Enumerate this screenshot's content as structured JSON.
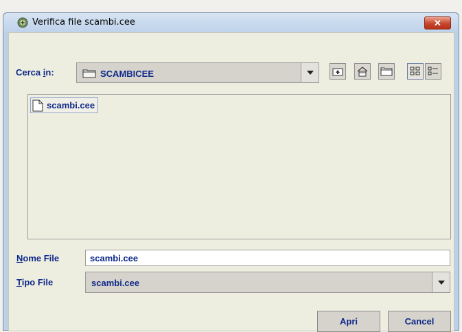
{
  "window": {
    "title": "Verifica file scambi.cee",
    "close_label": "✕"
  },
  "lookin": {
    "label_prefix": "Cerca ",
    "label_mnemonic": "i",
    "label_suffix": "n:",
    "folder": "SCAMBICEE"
  },
  "toolbar": {
    "icons": [
      "up-folder-icon",
      "home-icon",
      "new-folder-icon",
      "list-view-icon",
      "details-view-icon"
    ]
  },
  "files": [
    {
      "name": "scambi.cee",
      "icon": "file-icon"
    }
  ],
  "filename": {
    "label_mnemonic": "N",
    "label_rest": "ome File",
    "value": "scambi.cee"
  },
  "filetype": {
    "label_mnemonic": "T",
    "label_rest": "ipo File",
    "value": "scambi.cee"
  },
  "buttons": {
    "open": "Apri",
    "cancel": "Cancel"
  },
  "colors": {
    "label_text": "#0f2a8a",
    "panel_bg": "#eeeee0",
    "titlebar": "#bed2ea"
  }
}
